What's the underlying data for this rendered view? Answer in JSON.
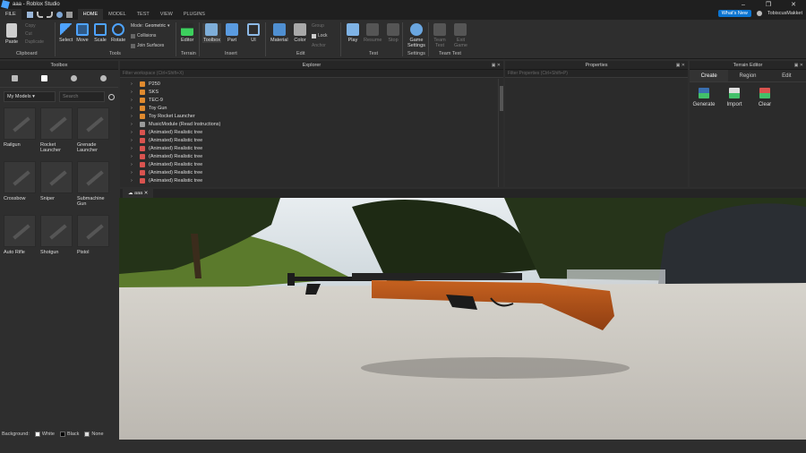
{
  "window": {
    "title": "aaa - Roblox Studio"
  },
  "menu": {
    "file": "FILE",
    "tabs": [
      "HOME",
      "MODEL",
      "TEST",
      "VIEW",
      "PLUGINS"
    ],
    "whats_new": "What's New",
    "user": "TobiscusMakket"
  },
  "ribbon": {
    "paste": "Paste",
    "copy": "Copy",
    "cut": "Cut",
    "duplicate": "Duplicate",
    "clipboard": "Clipboard",
    "select": "Select",
    "move": "Move",
    "scale": "Scale",
    "rotate": "Rotate",
    "tools": "Tools",
    "mode_label": "Mode:",
    "mode_value": "Geometric",
    "collisions": "Collisions",
    "join_surfaces": "Join Surfaces",
    "editor": "Editor",
    "terrain": "Terrain",
    "toolbox": "Toolbox",
    "part": "Part",
    "ui": "UI",
    "insert": "Insert",
    "material": "Material",
    "color": "Color",
    "group": "Group",
    "lock": "Lock",
    "anchor": "Anchor",
    "edit": "Edit",
    "play": "Play",
    "resume": "Resume",
    "stop": "Stop",
    "test": "Test",
    "game_settings_1": "Game",
    "game_settings_2": "Settings",
    "settings": "Settings",
    "team_test_1": "Team",
    "team_test_2": "Test",
    "exit_game_1": "Exit",
    "exit_game_2": "Game",
    "team_test": "Team Test"
  },
  "panels": {
    "toolbox_title": "Toolbox",
    "explorer_title": "Explorer",
    "properties_title": "Properties",
    "terrain_title": "Terrain Editor"
  },
  "toolbox": {
    "category": "My Models",
    "search_placeholder": "Search",
    "items": [
      {
        "label": "Railgun"
      },
      {
        "label": "Rocket Launcher"
      },
      {
        "label": "Grenade Launcher"
      },
      {
        "label": "Crossbow"
      },
      {
        "label": "Sniper"
      },
      {
        "label": "Submachine Gun"
      },
      {
        "label": "Auto Rifle"
      },
      {
        "label": "Shotgun"
      },
      {
        "label": "Pistol"
      }
    ],
    "background_label": "Background:",
    "bg_white": "White",
    "bg_black": "Black",
    "bg_none": "None"
  },
  "explorer": {
    "filter_placeholder": "Filter workspace (Ctrl+Shift+X)",
    "rows": [
      {
        "label": "P250",
        "color": "#e08a2e"
      },
      {
        "label": "SKS",
        "color": "#e08a2e"
      },
      {
        "label": "TEC-9",
        "color": "#e08a2e"
      },
      {
        "label": "Toy Gun",
        "color": "#e08a2e"
      },
      {
        "label": "Toy Rocket Launcher",
        "color": "#e08a2e"
      },
      {
        "label": "MusicModule (Read Instructions)",
        "color": "#9a9a9a"
      },
      {
        "label": "(Animated) Realistic tree",
        "color": "#d9534f"
      },
      {
        "label": "(Animated) Realistic tree",
        "color": "#d9534f"
      },
      {
        "label": "(Animated) Realistic tree",
        "color": "#d9534f"
      },
      {
        "label": "(Animated) Realistic tree",
        "color": "#d9534f"
      },
      {
        "label": "(Animated) Realistic tree",
        "color": "#d9534f"
      },
      {
        "label": "(Animated) Realistic tree",
        "color": "#d9534f"
      },
      {
        "label": "(Animated) Realistic tree",
        "color": "#d9534f"
      }
    ]
  },
  "properties": {
    "filter_placeholder": "Filter Properties (Ctrl+Shift+P)"
  },
  "terrain": {
    "tabs": [
      "Create",
      "Region",
      "Edit"
    ],
    "buttons": [
      "Generate",
      "Import",
      "Clear"
    ]
  },
  "viewport": {
    "tab_label": "aaa"
  }
}
